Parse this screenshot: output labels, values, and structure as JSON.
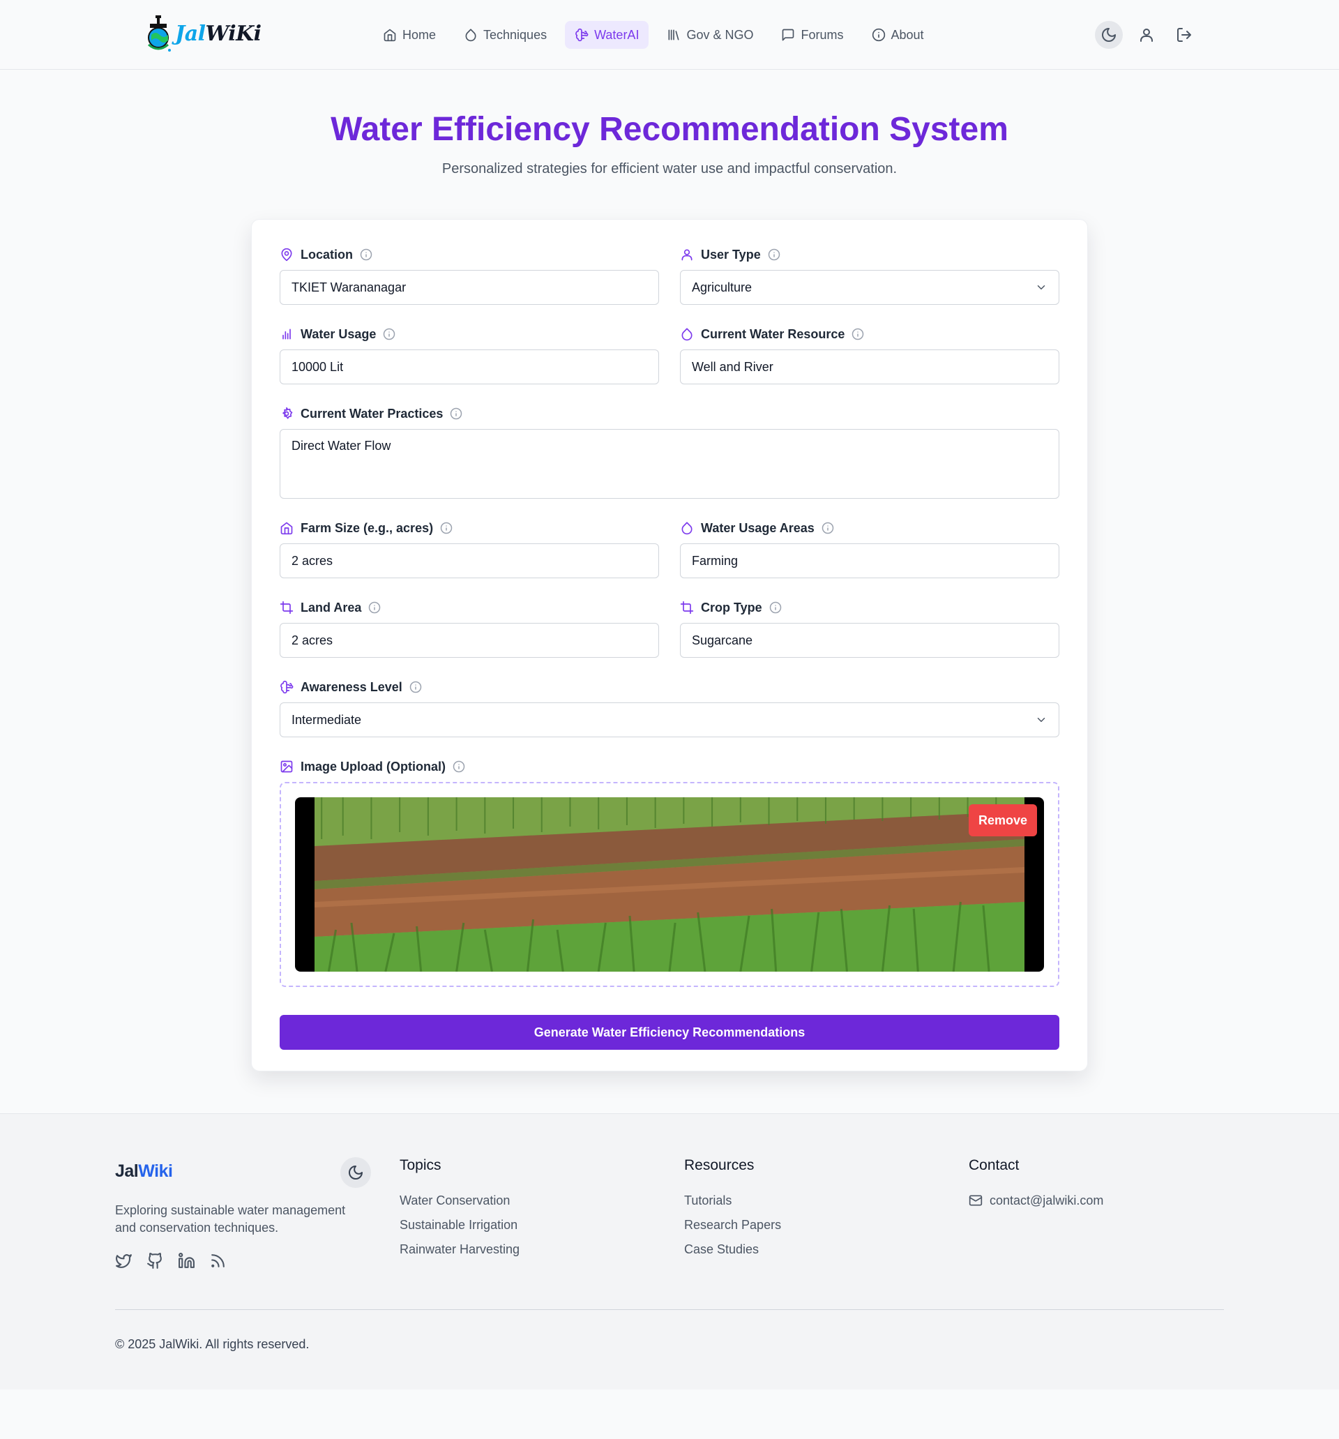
{
  "brand": {
    "jal": "Jal",
    "wiki": "WiKi"
  },
  "nav": {
    "items": [
      {
        "label": "Home",
        "icon": "home-icon"
      },
      {
        "label": "Techniques",
        "icon": "droplet-icon"
      },
      {
        "label": "WaterAI",
        "icon": "brain-icon",
        "active": true
      },
      {
        "label": "Gov & NGO",
        "icon": "library-icon"
      },
      {
        "label": "Forums",
        "icon": "message-square-icon"
      },
      {
        "label": "About",
        "icon": "info-icon"
      }
    ]
  },
  "hero": {
    "title": "Water Efficiency Recommendation System",
    "subtitle": "Personalized strategies for efficient water use and impactful conservation."
  },
  "form": {
    "location": {
      "label": "Location",
      "value": "TKIET Warananagar"
    },
    "user_type": {
      "label": "User Type",
      "value": "Agriculture"
    },
    "water_usage": {
      "label": "Water Usage",
      "value": "10000 Lit"
    },
    "water_resource": {
      "label": "Current Water Resource",
      "value": "Well and River"
    },
    "practices": {
      "label": "Current Water Practices",
      "value": "Direct Water Flow"
    },
    "farm_size": {
      "label": "Farm Size (e.g., acres)",
      "value": "2 acres"
    },
    "usage_areas": {
      "label": "Water Usage Areas",
      "value": "Farming"
    },
    "land_area": {
      "label": "Land Area",
      "value": "2 acres"
    },
    "crop_type": {
      "label": "Crop Type",
      "value": "Sugarcane"
    },
    "awareness": {
      "label": "Awareness Level",
      "value": "Intermediate"
    },
    "image_upload": {
      "label": "Image Upload (Optional)",
      "remove_label": "Remove"
    },
    "submit_label": "Generate Water Efficiency Recommendations"
  },
  "footer": {
    "brand_a": "Jal",
    "brand_b": "Wiki",
    "description": "Exploring sustainable water management and conservation techniques.",
    "topics": {
      "title": "Topics",
      "links": [
        "Water Conservation",
        "Sustainable Irrigation",
        "Rainwater Harvesting"
      ]
    },
    "resources": {
      "title": "Resources",
      "links": [
        "Tutorials",
        "Research Papers",
        "Case Studies"
      ]
    },
    "contact": {
      "title": "Contact",
      "email": "contact@jalwiki.com"
    },
    "copyright": "© 2025 JalWiki. All rights reserved."
  },
  "colors": {
    "primary": "#6d28d9",
    "accent": "#7c3aed",
    "danger": "#ef4444",
    "brand_blue": "#2563eb"
  }
}
